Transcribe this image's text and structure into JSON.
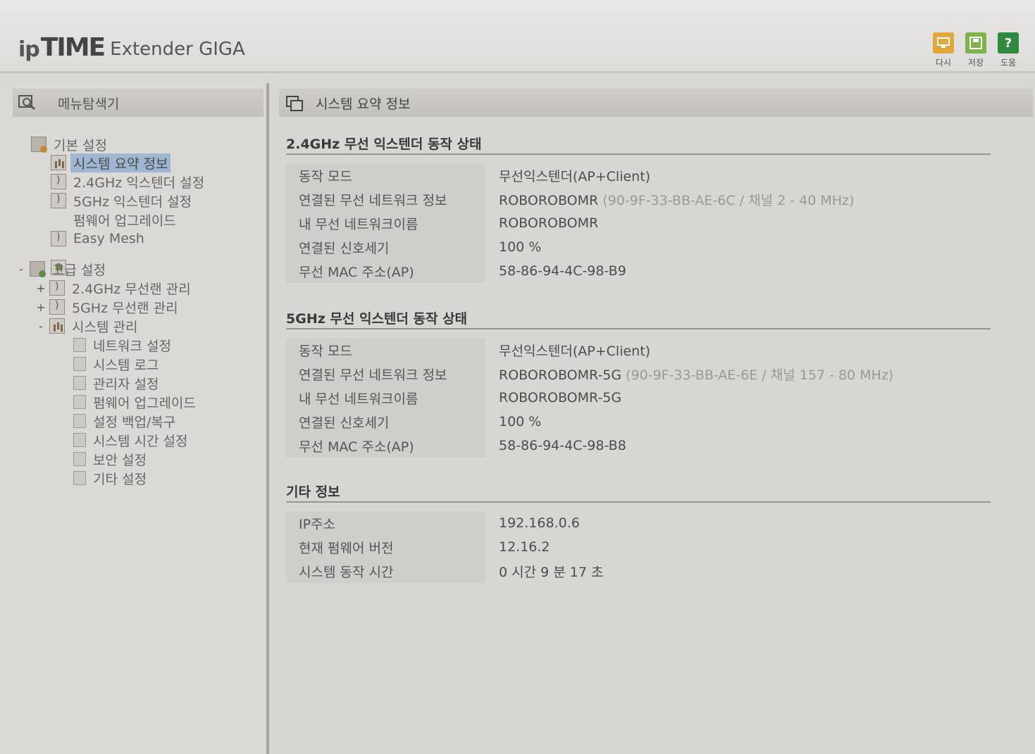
{
  "header": {
    "logo_ip": "ip",
    "logo_time": "TIME",
    "product": "Extender GIGA",
    "tools": [
      {
        "name": "refresh",
        "label": "다시",
        "color": "#e0a83a",
        "icon": "monitor-icon"
      },
      {
        "name": "save",
        "label": "저장",
        "color": "#7fb24a",
        "icon": "floppy-icon"
      },
      {
        "name": "help",
        "label": "도움",
        "color": "#2f8a3f",
        "icon": "help-icon",
        "glyph": "?"
      }
    ]
  },
  "sidebar": {
    "title": "메뉴탐색기",
    "groups": {
      "basic": {
        "label": "기본 설정"
      },
      "basic_items": [
        "시스템 요약 정보",
        "2.4GHz 익스텐더 설정",
        "5GHz 익스텐더 설정",
        "펌웨어 업그레이드",
        "Easy Mesh"
      ],
      "advanced": {
        "label": "고급 설정",
        "toggle": "-"
      },
      "advanced_items": [
        {
          "label": "2.4GHz 무선랜 관리",
          "toggle": "+"
        },
        {
          "label": "5GHz 무선랜 관리",
          "toggle": "+"
        },
        {
          "label": "시스템 관리",
          "toggle": "-"
        }
      ],
      "system_items": [
        "네트워크 설정",
        "시스템 로그",
        "관리자 설정",
        "펌웨어 업그레이드",
        "설정 백업/복구",
        "시스템 시간 설정",
        "보안 설정",
        "기타 설정"
      ]
    }
  },
  "main": {
    "title": "시스템 요약 정보",
    "sections": [
      {
        "title": "2.4GHz 무선 익스텐더 동작 상태",
        "rows": [
          {
            "k": "동작 모드",
            "v": "무선익스텐더(AP+Client)",
            "extra": ""
          },
          {
            "k": "연결된 무선 네트워크 정보",
            "v": "ROBOROBOMR",
            "extra": "(90-9F-33-BB-AE-6C / 채널 2 - 40 MHz)"
          },
          {
            "k": "내 무선 네트워크이름",
            "v": "ROBOROBOMR",
            "extra": ""
          },
          {
            "k": "연결된 신호세기",
            "v": "100 %",
            "extra": ""
          },
          {
            "k": "무선 MAC 주소(AP)",
            "v": "58-86-94-4C-98-B9",
            "extra": ""
          }
        ]
      },
      {
        "title": "5GHz 무선 익스텐더 동작 상태",
        "rows": [
          {
            "k": "동작 모드",
            "v": "무선익스텐더(AP+Client)",
            "extra": ""
          },
          {
            "k": "연결된 무선 네트워크 정보",
            "v": "ROBOROBOMR-5G",
            "extra": "(90-9F-33-BB-AE-6E / 채널 157 - 80 MHz)"
          },
          {
            "k": "내 무선 네트워크이름",
            "v": "ROBOROBOMR-5G",
            "extra": ""
          },
          {
            "k": "연결된 신호세기",
            "v": "100 %",
            "extra": ""
          },
          {
            "k": "무선 MAC 주소(AP)",
            "v": "58-86-94-4C-98-B8",
            "extra": ""
          }
        ]
      },
      {
        "title": "기타 정보",
        "rows": [
          {
            "k": "IP주소",
            "v": "192.168.0.6",
            "extra": ""
          },
          {
            "k": "현재 펌웨어 버전",
            "v": "12.16.2",
            "extra": ""
          },
          {
            "k": "시스템 동작 시간",
            "v": "0 시간 9 분 17 초",
            "extra": ""
          }
        ]
      }
    ]
  }
}
